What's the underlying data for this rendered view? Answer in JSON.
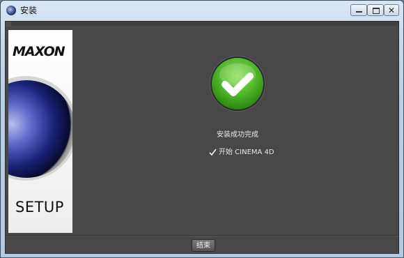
{
  "window": {
    "title": "安装"
  },
  "banner": {
    "logo": "MAXON",
    "setup_text": "SETUP"
  },
  "content": {
    "status_message": "安装成功完成",
    "launch_checkbox": {
      "label": "开始 CINEMA 4D",
      "checked": true
    }
  },
  "footer": {
    "finish_label": "结束"
  },
  "colors": {
    "success_green": "#4fb529",
    "panel_bg": "#484848"
  }
}
